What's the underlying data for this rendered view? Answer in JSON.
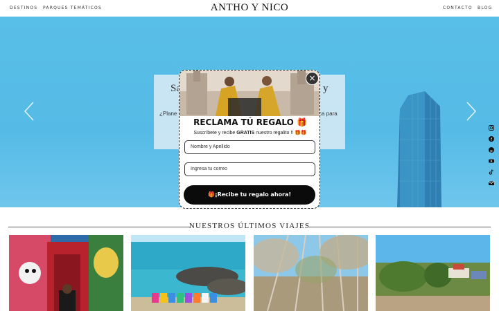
{
  "nav": {
    "left_links": [
      "DESTINOS",
      "PARQUES TEMÁTICOS"
    ],
    "brand": "ANTHO Y NICO",
    "right_links": [
      "CONTACTO",
      "BLOG"
    ]
  },
  "hero": {
    "title_fragment_left": "Sa",
    "title_fragment_right": "y",
    "text_fragment_left": "¿Plane",
    "text_fragment_right": "ca para",
    "prev_icon": "chevron-left-icon",
    "next_icon": "chevron-right-icon"
  },
  "social_icons": [
    "instagram-icon",
    "facebook-icon",
    "pinterest-icon",
    "youtube-icon",
    "tiktok-icon",
    "email-icon"
  ],
  "section": {
    "title": "NUESTROS ÚLTIMOS VIAJES"
  },
  "popup": {
    "title": "RECLAMA TÚ REGALO 🎁",
    "subtitle_before": "Suscríbete y recibe ",
    "subtitle_bold": "GRATIS",
    "subtitle_after": " nuestro regalito !! 🎁🎁",
    "name_placeholder": "Nombre y Apellido",
    "email_placeholder": "Ingresa tu correo",
    "cta_label": "🎁¡Recibe tu regalo ahora!",
    "close_label": "×"
  },
  "colors": {
    "sky": "#58bfe8",
    "popup_button": "#0b0b0b",
    "hero_box": "#d2e8f5"
  }
}
